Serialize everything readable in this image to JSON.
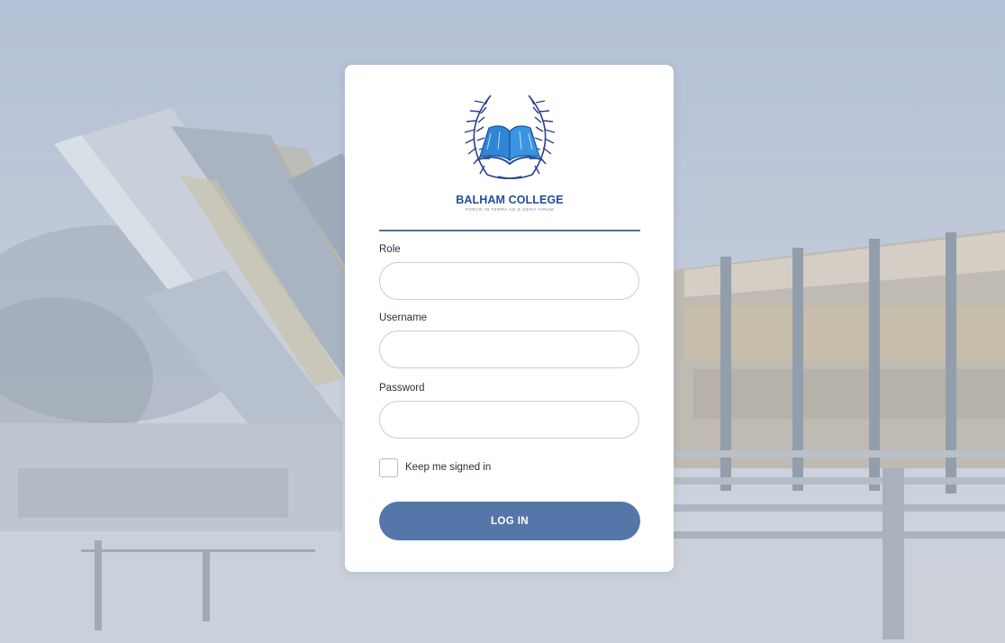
{
  "brand": {
    "name": "BALHAM COLLEGE",
    "motto": "FORCE IN TERRA AD & GERA VIRUM",
    "colors": {
      "primary": "#1f4e96",
      "book": "#2f86d4",
      "wreath": "#2a3f8f",
      "button": "#5576a8"
    }
  },
  "form": {
    "role": {
      "label": "Role",
      "value": ""
    },
    "username": {
      "label": "Username",
      "value": ""
    },
    "password": {
      "label": "Password",
      "value": ""
    },
    "remember": {
      "label": "Keep me signed in",
      "checked": false
    },
    "submit_label": "LOG IN"
  },
  "icons": {
    "logo": "book-laurel-emblem",
    "background": "campus-building-photo"
  }
}
